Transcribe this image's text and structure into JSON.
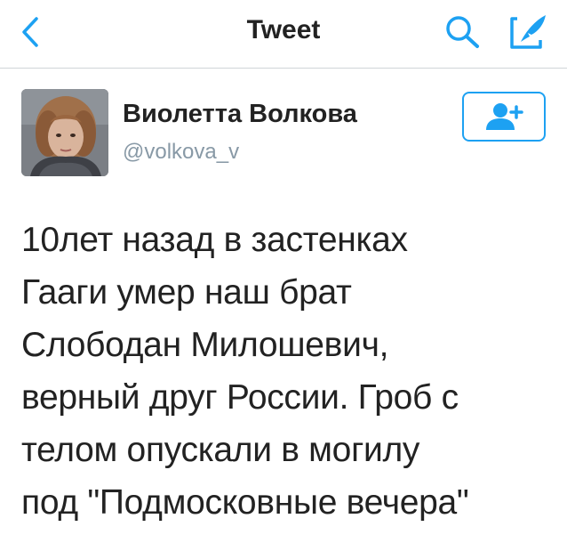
{
  "navbar": {
    "title": "Tweet",
    "back_icon": "chevron-left-icon",
    "search_icon": "search-icon",
    "compose_icon": "compose-tweet-icon"
  },
  "author": {
    "display_name": "Виолетта Волкова",
    "handle": "@volkova_v",
    "follow_icon": "follow-user-icon"
  },
  "tweet": {
    "lines": [
      "10лет назад в застенках",
      "Гааги умер наш брат",
      "Слободан Милошевич,",
      "верный друг России. Гроб с",
      "телом опускали в могилу",
      "под \"Подмосковные вечера\""
    ]
  },
  "colors": {
    "accent": "#1da1f2",
    "text": "#222222",
    "secondary_text": "#8899a6",
    "divider": "#cfd4d8"
  }
}
